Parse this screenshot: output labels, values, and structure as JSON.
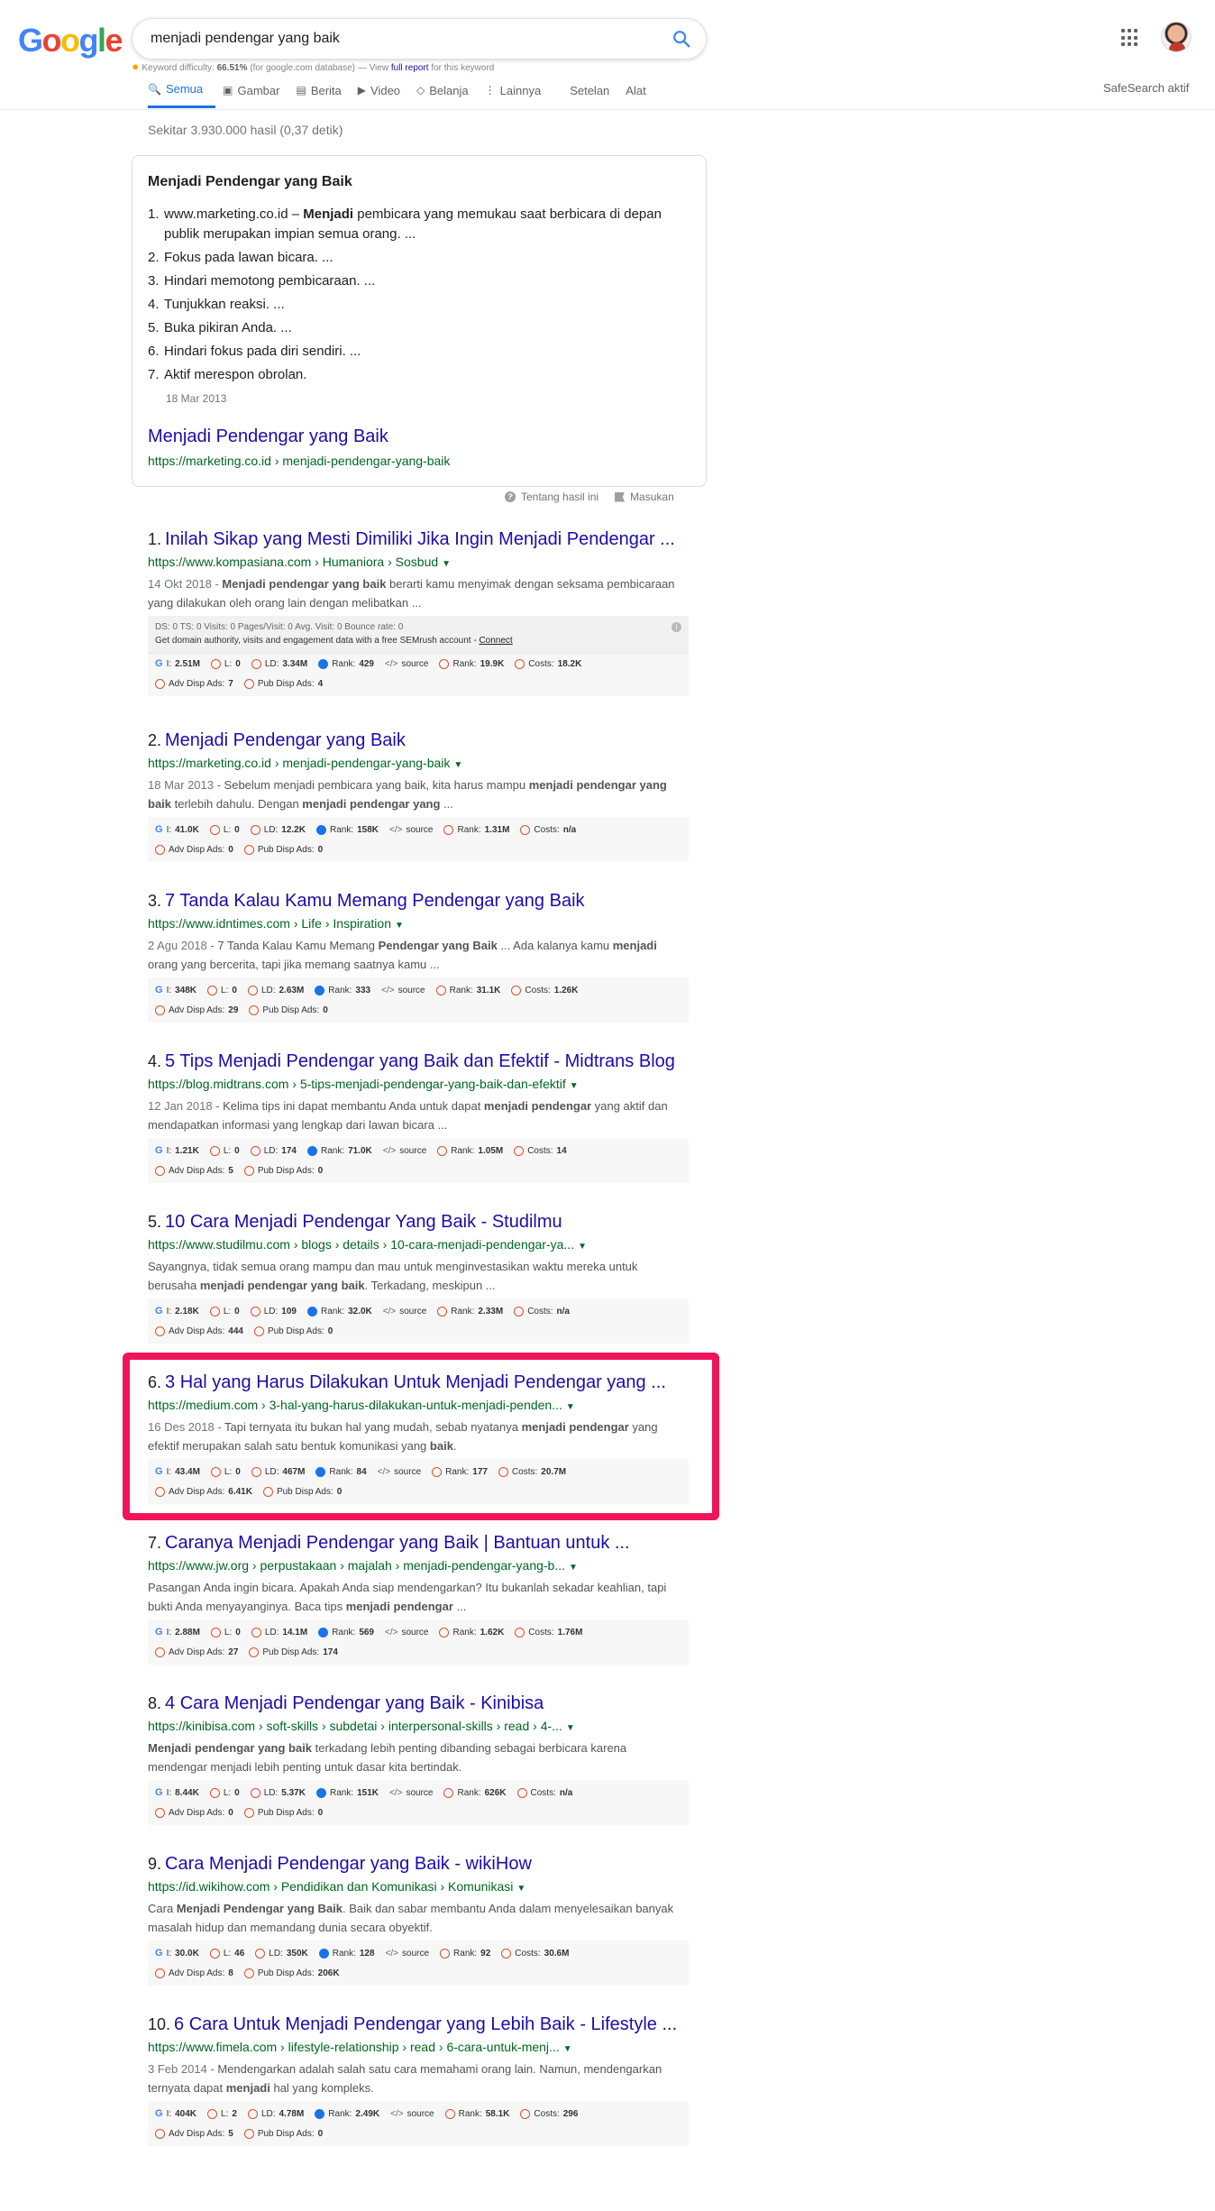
{
  "logo": "Google",
  "search": {
    "query": "menjadi pendengar yang baik"
  },
  "keyword_difficulty": {
    "label": "Keyword difficulty:",
    "value": "66.51%",
    "db": "(for google.com database) — View",
    "link": "full report",
    "tail": "for this keyword"
  },
  "tabs": [
    {
      "label": "Semua",
      "icon": "🔍"
    },
    {
      "label": "Gambar",
      "icon": "▣"
    },
    {
      "label": "Berita",
      "icon": "▤"
    },
    {
      "label": "Video",
      "icon": "▶"
    },
    {
      "label": "Belanja",
      "icon": "◇"
    },
    {
      "label": "Lainnya",
      "icon": "⋮"
    },
    {
      "label": "Setelan",
      "icon": ""
    },
    {
      "label": "Alat",
      "icon": ""
    }
  ],
  "safesearch": "SafeSearch aktif",
  "stats": "Sekitar 3.930.000 hasil (0,37 detik)",
  "snippet": {
    "heading": "Menjadi Pendengar yang Baik",
    "items": [
      {
        "n": "1.",
        "pre": "www.marketing.co.id – ",
        "bold": "Menjadi",
        "post": " pembicara yang memukau saat berbicara di depan publik merupakan impian semua orang. ..."
      },
      {
        "n": "2.",
        "pre": "Fokus pada lawan bicara. ...",
        "bold": "",
        "post": ""
      },
      {
        "n": "3.",
        "pre": "Hindari memotong pembicaraan. ...",
        "bold": "",
        "post": ""
      },
      {
        "n": "4.",
        "pre": "Tunjukkan reaksi. ...",
        "bold": "",
        "post": ""
      },
      {
        "n": "5.",
        "pre": "Buka pikiran Anda. ...",
        "bold": "",
        "post": ""
      },
      {
        "n": "6.",
        "pre": "Hindari fokus pada diri sendiri. ...",
        "bold": "",
        "post": ""
      },
      {
        "n": "7.",
        "pre": "Aktif merespon obrolan.",
        "bold": "",
        "post": ""
      }
    ],
    "date": "18 Mar 2013",
    "title": "Menjadi Pendengar yang Baik",
    "url": "https://marketing.co.id › menjadi-pendengar-yang-baik"
  },
  "feedback": {
    "about": "Tentang hasil ini",
    "report": "Masukan"
  },
  "semrush_top": {
    "line1": "DS: 0   TS: 0   Visits: 0   Pages/Visit: 0   Avg. Visit: 0   Bounce rate: 0",
    "line2_pre": "Get domain authority, visits and engagement data with a free SEMrush account -",
    "line2_link": "Connect"
  },
  "results": [
    {
      "num": "1.",
      "title": "Inilah Sikap yang Mesti Dimiliki Jika Ingin Menjadi Pendengar ...",
      "url": "https://www.kompasiana.com › Humaniora › Sosbud",
      "date": "14 Okt 2018 - ",
      "snippet_html": "<b>Menjadi pendengar yang baik</b> berarti kamu menyimak dengan seksama pembicaraan yang dilakukan oleh orang lain dengan melibatkan ...",
      "metrics": {
        "i": "2.51M",
        "l": "0",
        "ld": "3.34M",
        "rank": "429",
        "rank2": "19.9K",
        "costs": "18.2K",
        "adv": "7",
        "pub": "4"
      }
    },
    {
      "num": "2.",
      "title": "Menjadi Pendengar yang Baik",
      "url": "https://marketing.co.id › menjadi-pendengar-yang-baik",
      "date": "18 Mar 2013 - ",
      "snippet_html": "Sebelum menjadi pembicara yang baik, kita harus mampu <b>menjadi pendengar yang baik</b> terlebih dahulu. Dengan <b>menjadi pendengar yang</b> ...",
      "metrics": {
        "i": "41.0K",
        "l": "0",
        "ld": "12.2K",
        "rank": "158K",
        "rank2": "1.31M",
        "costs": "n/a",
        "adv": "0",
        "pub": "0"
      }
    },
    {
      "num": "3.",
      "title": "7 Tanda Kalau Kamu Memang Pendengar yang Baik",
      "url": "https://www.idntimes.com › Life › Inspiration",
      "date": "2 Agu 2018 - ",
      "snippet_html": "7 Tanda Kalau Kamu Memang <b>Pendengar yang Baik</b> ... Ada kalanya kamu <b>menjadi</b> orang yang bercerita, tapi jika memang saatnya kamu ...",
      "metrics": {
        "i": "348K",
        "l": "0",
        "ld": "2.63M",
        "rank": "333",
        "rank2": "31.1K",
        "costs": "1.26K",
        "adv": "29",
        "pub": "0"
      }
    },
    {
      "num": "4.",
      "title": "5 Tips Menjadi Pendengar yang Baik dan Efektif - Midtrans Blog",
      "url": "https://blog.midtrans.com › 5-tips-menjadi-pendengar-yang-baik-dan-efektif",
      "date": "12 Jan 2018 - ",
      "snippet_html": "Kelima tips ini dapat membantu Anda untuk dapat <b>menjadi pendengar</b> yang aktif dan mendapatkan informasi yang lengkap dari lawan bicara ...",
      "metrics": {
        "i": "1.21K",
        "l": "0",
        "ld": "174",
        "rank": "71.0K",
        "rank2": "1.05M",
        "costs": "14",
        "adv": "5",
        "pub": "0"
      }
    },
    {
      "num": "5.",
      "title": "10 Cara Menjadi Pendengar Yang Baik - Studilmu",
      "url": "https://www.studilmu.com › blogs › details › 10-cara-menjadi-pendengar-ya...",
      "date": "",
      "snippet_html": "Sayangnya, tidak semua orang mampu dan mau untuk menginvestasikan waktu mereka untuk berusaha <b>menjadi pendengar yang baik</b>. Terkadang, meskipun ...",
      "metrics": {
        "i": "2.18K",
        "l": "0",
        "ld": "109",
        "rank": "32.0K",
        "rank2": "2.33M",
        "costs": "n/a",
        "adv": "444",
        "pub": "0"
      }
    },
    {
      "num": "6.",
      "title": "3 Hal yang Harus Dilakukan Untuk Menjadi Pendengar yang ...",
      "url": "https://medium.com › 3-hal-yang-harus-dilakukan-untuk-menjadi-penden...",
      "date": "16 Des 2018 - ",
      "snippet_html": "Tapi ternyata itu bukan hal yang mudah, sebab nyatanya <b>menjadi pendengar</b> yang efektif merupakan salah satu bentuk komunikasi yang <b>baik</b>.",
      "metrics": {
        "i": "43.4M",
        "l": "0",
        "ld": "467M",
        "rank": "84",
        "rank2": "177",
        "costs": "20.7M",
        "adv": "6.41K",
        "pub": "0"
      }
    },
    {
      "num": "7.",
      "title": "Caranya Menjadi Pendengar yang Baik | Bantuan untuk ...",
      "url": "https://www.jw.org › perpustakaan › majalah › menjadi-pendengar-yang-b...",
      "date": "",
      "snippet_html": "Pasangan Anda ingin bicara. Apakah Anda siap mendengarkan? Itu bukanlah sekadar keahlian, tapi bukti Anda menyayanginya. Baca tips <b>menjadi pendengar</b> ...",
      "metrics": {
        "i": "2.88M",
        "l": "0",
        "ld": "14.1M",
        "rank": "569",
        "rank2": "1.62K",
        "costs": "1.76M",
        "adv": "27",
        "pub": "174"
      }
    },
    {
      "num": "8.",
      "title": "4 Cara Menjadi Pendengar yang Baik - Kinibisa",
      "url": "https://kinibisa.com › soft-skills › subdetai › interpersonal-skills › read › 4-...",
      "date": "",
      "snippet_html": "<b>Menjadi pendengar yang baik</b> terkadang lebih penting dibanding sebagai berbicara karena mendengar menjadi lebih penting untuk dasar kita bertindak.",
      "metrics": {
        "i": "8.44K",
        "l": "0",
        "ld": "5.37K",
        "rank": "151K",
        "rank2": "626K",
        "costs": "n/a",
        "adv": "0",
        "pub": "0"
      }
    },
    {
      "num": "9.",
      "title": "Cara Menjadi Pendengar yang Baik - wikiHow",
      "url": "https://id.wikihow.com › Pendidikan dan Komunikasi › Komunikasi",
      "date": "",
      "snippet_html": "Cara <b>Menjadi Pendengar yang Baik</b>. Baik dan sabar membantu Anda dalam menyelesaikan banyak masalah hidup dan memandang dunia secara obyektif.",
      "metrics": {
        "i": "30.0K",
        "l": "46",
        "ld": "350K",
        "rank": "128",
        "rank2": "92",
        "costs": "30.6M",
        "adv": "8",
        "pub": "206K"
      }
    },
    {
      "num": "10.",
      "title": "6 Cara Untuk Menjadi Pendengar yang Lebih Baik - Lifestyle ...",
      "url": "https://www.fimela.com › lifestyle-relationship › read › 6-cara-untuk-menj...",
      "date": "3 Feb 2014 - ",
      "snippet_html": "Mendengarkan adalah salah satu cara memahami orang lain. Namun, mendengarkan ternyata dapat <b>menjadi</b> hal yang kompleks.",
      "metrics": {
        "i": "404K",
        "l": "2",
        "ld": "4.78M",
        "rank": "2.49K",
        "rank2": "58.1K",
        "costs": "296",
        "adv": "5",
        "pub": "0"
      }
    }
  ],
  "labels": {
    "i": "I:",
    "l": "L:",
    "ld": "LD:",
    "rank": "Rank:",
    "source": "source",
    "costs": "Costs:",
    "adv": "Adv Disp Ads:",
    "pub": "Pub Disp Ads:"
  },
  "colors": {
    "link": "#1a0dab",
    "url": "#006621",
    "highlight": "#f0145a",
    "accent": "#1a73e8"
  }
}
